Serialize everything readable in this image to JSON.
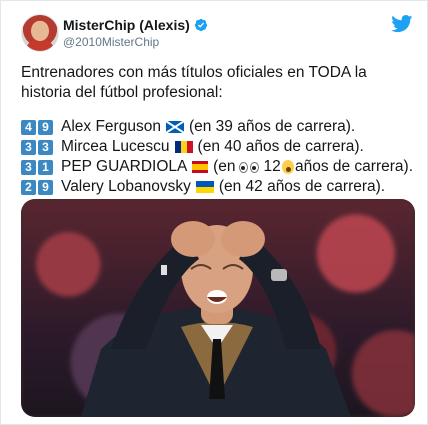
{
  "account": {
    "display_name": "MisterChip (Alexis)",
    "handle": "@2010MisterChip",
    "verified": true
  },
  "icons": {
    "platform": "twitter-bird-icon",
    "verified": "verified-badge-icon"
  },
  "colors": {
    "twitter_blue": "#1da1f2",
    "keycap_blue": "#3b88c3"
  },
  "tweet": {
    "intro": "Entrenadores con más títulos oficiales en TODA la historia del fútbol profesional:",
    "coaches": [
      {
        "digits": [
          "4",
          "9"
        ],
        "name": "Alex Ferguson",
        "flag": "scotland",
        "note": "(en 39 años de carrera)."
      },
      {
        "digits": [
          "3",
          "3"
        ],
        "name": "Mircea Lucescu",
        "flag": "romania",
        "note": "(en 40 años de carrera)."
      },
      {
        "digits": [
          "3",
          "1"
        ],
        "name": "PEP GUARDIOLA",
        "flag": "spain",
        "note_pre": "(en",
        "note_num": "12",
        "note_post": "años de carrera)."
      },
      {
        "digits": [
          "2",
          "9"
        ],
        "name": "Valery Lobanovsky",
        "flag": "ukraine",
        "note": "(en 42 años de carrera)."
      }
    ]
  }
}
